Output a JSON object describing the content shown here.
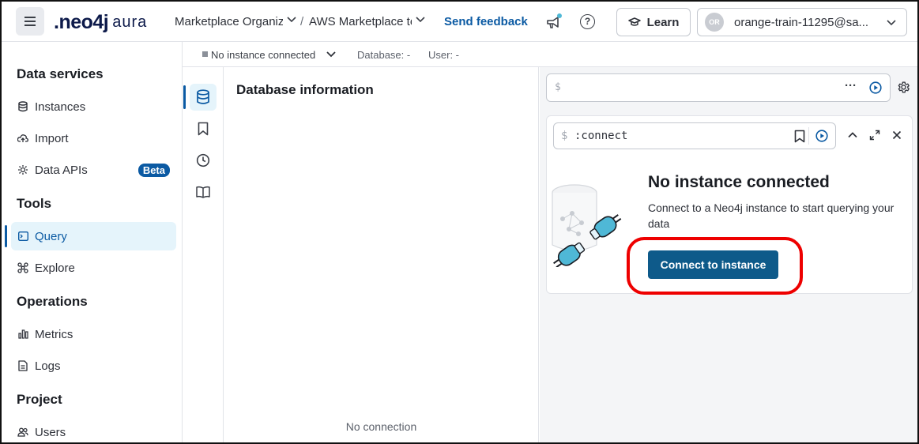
{
  "header": {
    "logo_main": ".neo4j",
    "logo_sub": "aura",
    "breadcrumb_org": "Marketplace Organization",
    "breadcrumb_sep": "/",
    "breadcrumb_project": "AWS Marketplace tenant",
    "feedback_label": "Send feedback",
    "help_label": "?",
    "learn_label": "Learn",
    "account_initials": "OR",
    "account_label": "orange-train-11295@sa..."
  },
  "subbar": {
    "status": "No instance connected",
    "database_label": "Database: -",
    "user_label": "User: -"
  },
  "sidebar": {
    "sections": [
      {
        "title": "Data services",
        "items": [
          {
            "label": "Instances",
            "icon": "database-icon"
          },
          {
            "label": "Import",
            "icon": "cloud-upload-icon"
          },
          {
            "label": "Data APIs",
            "icon": "api-icon",
            "badge": "Beta"
          }
        ]
      },
      {
        "title": "Tools",
        "items": [
          {
            "label": "Query",
            "icon": "query-icon",
            "active": true
          },
          {
            "label": "Explore",
            "icon": "explore-icon"
          }
        ]
      },
      {
        "title": "Operations",
        "items": [
          {
            "label": "Metrics",
            "icon": "metrics-icon"
          },
          {
            "label": "Logs",
            "icon": "logs-icon"
          }
        ]
      },
      {
        "title": "Project",
        "items": [
          {
            "label": "Users",
            "icon": "users-icon"
          }
        ]
      }
    ]
  },
  "db_panel": {
    "title": "Database information",
    "empty_text": "No connection"
  },
  "query": {
    "editor_prompt": "$",
    "frame_prompt": "$",
    "frame_command": ":connect",
    "card_title": "No instance connected",
    "card_description": "Connect to a Neo4j instance to start querying your data",
    "connect_button": "Connect to instance"
  },
  "colors": {
    "accent": "#0b5aa3",
    "button": "#0e5a8a",
    "highlight": "#e00000",
    "active_bg": "#e5f4fb"
  }
}
